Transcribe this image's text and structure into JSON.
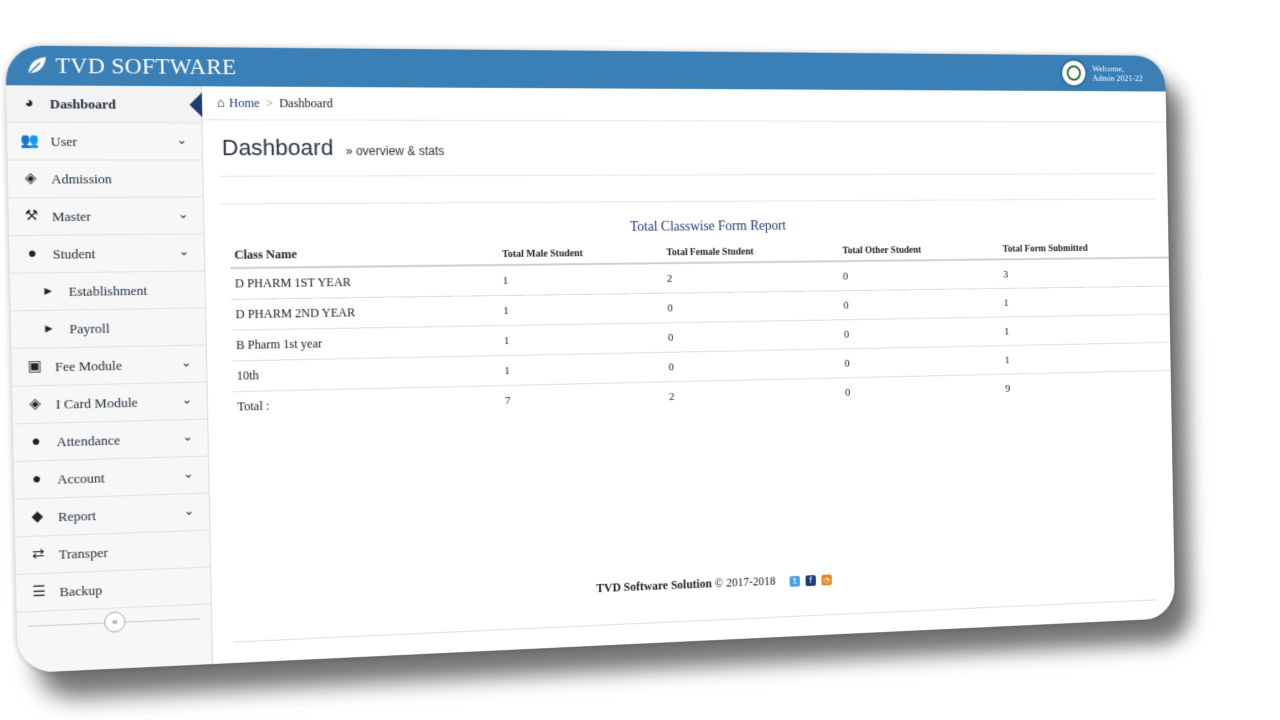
{
  "topbar": {
    "brand": "TVD SOFTWARE",
    "welcome_line1": "Welcome,",
    "welcome_line2": "Admin 2021-22"
  },
  "sidebar": {
    "items": [
      {
        "label": "Dashboard",
        "icon": "dashboard-icon",
        "active": true
      },
      {
        "label": "User",
        "icon": "users-icon",
        "has_children": true
      },
      {
        "label": "Admission",
        "icon": "ticket-icon"
      },
      {
        "label": "Master",
        "icon": "gavel-icon",
        "has_children": true
      },
      {
        "label": "Student",
        "icon": "user-icon",
        "has_children": true
      },
      {
        "label": "Establishment",
        "icon": "caret-right-icon",
        "sub": true
      },
      {
        "label": "Payroll",
        "icon": "caret-right-icon",
        "sub": true
      },
      {
        "label": "Fee Module",
        "icon": "money-icon",
        "has_children": true
      },
      {
        "label": "I Card Module",
        "icon": "ticket-icon",
        "has_children": true
      },
      {
        "label": "Attendance",
        "icon": "user-icon",
        "has_children": true
      },
      {
        "label": "Account",
        "icon": "user-icon",
        "has_children": true
      },
      {
        "label": "Report",
        "icon": "tag-icon",
        "has_children": true
      },
      {
        "label": "Transper",
        "icon": "exchange-icon"
      },
      {
        "label": "Backup",
        "icon": "database-icon"
      }
    ],
    "collapse_glyph": "«"
  },
  "breadcrumb": {
    "home": "Home",
    "separator": ">",
    "current": "Dashboard"
  },
  "page": {
    "title": "Dashboard",
    "subtitle": "» overview & stats"
  },
  "report": {
    "title": "Total Classwise Form Report",
    "columns": [
      "Class Name",
      "Total Male Student",
      "Total Female Student",
      "Total Other Student",
      "Total Form Submitted"
    ],
    "rows": [
      [
        "D PHARM 1ST YEAR",
        "1",
        "2",
        "0",
        "3"
      ],
      [
        "D PHARM 2ND YEAR",
        "1",
        "0",
        "0",
        "1"
      ],
      [
        "B Pharm 1st year",
        "1",
        "0",
        "0",
        "1"
      ],
      [
        "10th",
        "1",
        "0",
        "0",
        "1"
      ]
    ],
    "total": [
      "Total :",
      "7",
      "2",
      "0",
      "9"
    ]
  },
  "footer": {
    "company": "TVD Software Solution",
    "copyright": "© 2017-2018"
  },
  "colors": {
    "topbar": "#3a7fb6",
    "accent": "#1f3d73"
  }
}
